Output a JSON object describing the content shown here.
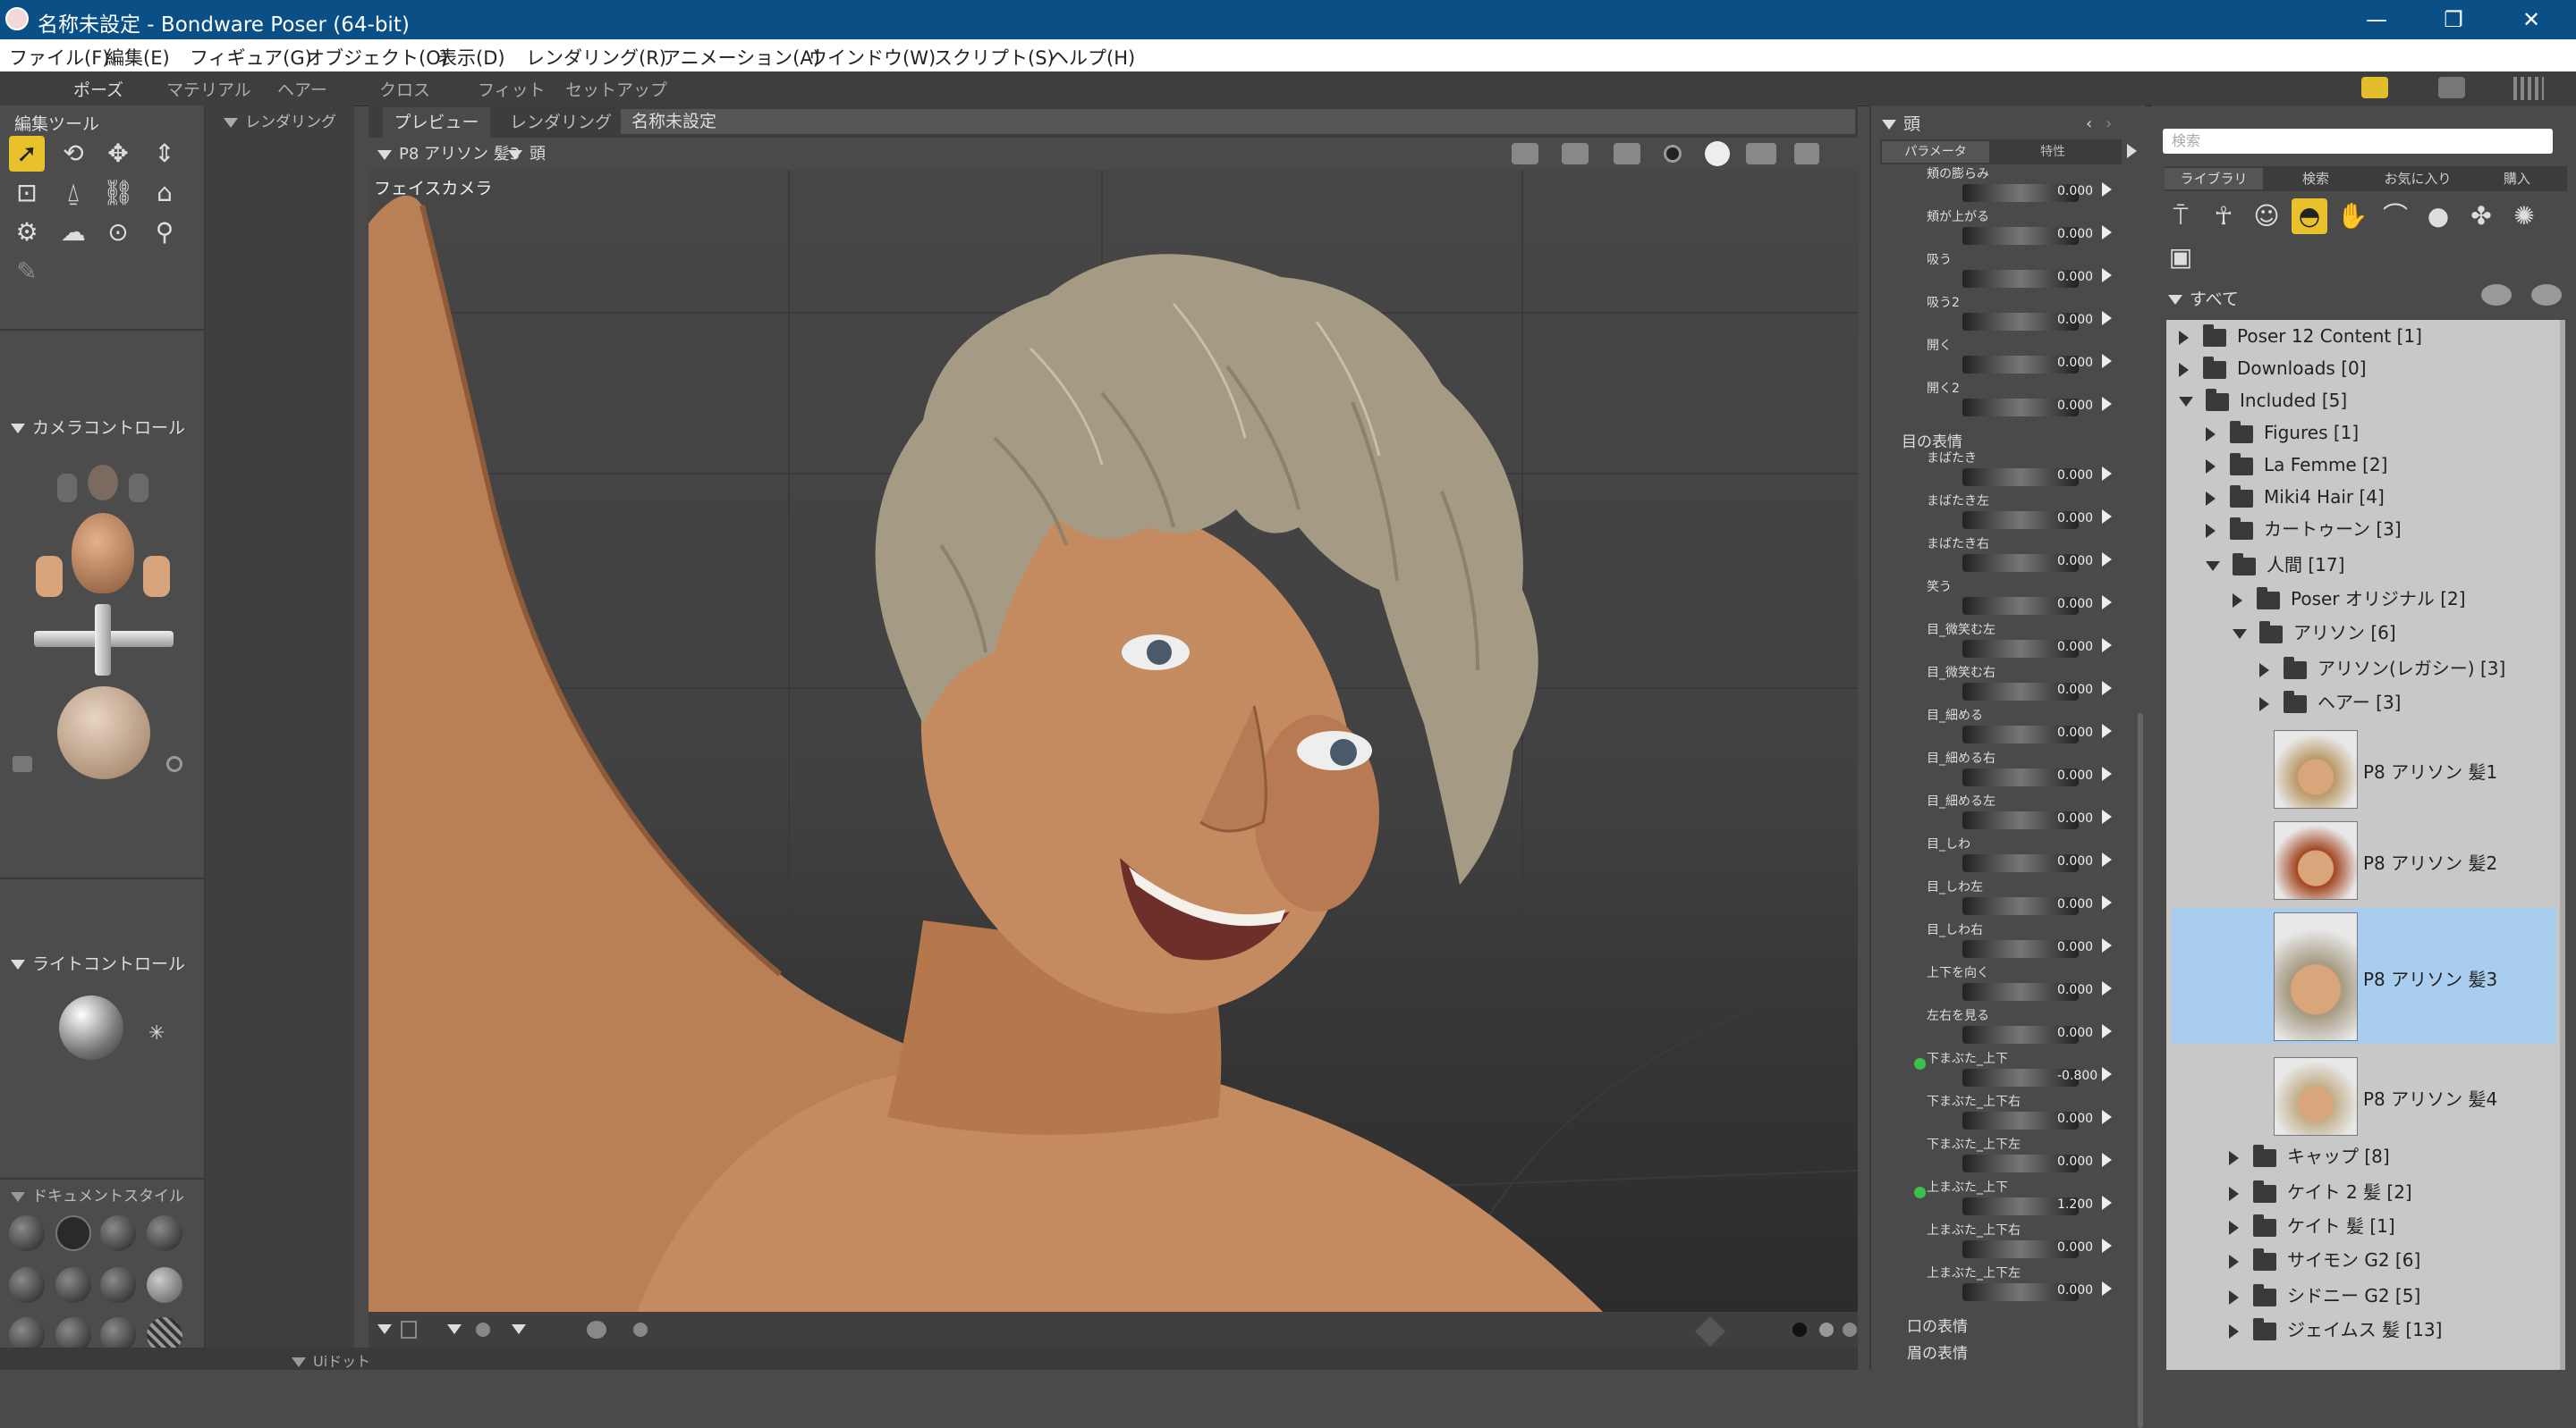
{
  "window": {
    "title": "名称未設定 - Bondware Poser (64-bit)",
    "minimize": "—",
    "restore": "❐",
    "close": "✕"
  },
  "menu": [
    "ファイル(F)",
    "編集(E)",
    "フィギュア(G)",
    "オブジェクト(O)",
    "表示(D)",
    "レンダリング(R)",
    "アニメーション(A)",
    "ウインドウ(W)",
    "スクリプト(S)",
    "ヘルプ(H)"
  ],
  "rooms": [
    "ポーズ",
    "マテリアル",
    "ヘアー",
    "クロス",
    "フィット",
    "セットアップ"
  ],
  "left": {
    "edit_tools": "編集ツール",
    "render_tab": "レンダリング",
    "camera_controls": "カメラコントロール",
    "light_controls": "ライトコントロール",
    "document_style": "ドキュメントスタイル"
  },
  "viewport": {
    "tabs": [
      "プレビュー",
      "レンダリング"
    ],
    "doc_title": "名称未設定",
    "figure_select": "P8 アリソン 髪3",
    "part_select": "頭",
    "camera_label": "フェイスカメラ"
  },
  "params": {
    "header": "頭",
    "tabs": [
      "パラメータ",
      "特性"
    ],
    "section_eye": "目の表情",
    "section_mouth": "口の表情",
    "section_eyebrow": "眉の表情",
    "rows": [
      {
        "label": "頬の膨らみ",
        "value": "0.000"
      },
      {
        "label": "頬が上がる",
        "value": "0.000"
      },
      {
        "label": "吸う",
        "value": "0.000"
      },
      {
        "label": "吸う2",
        "value": "0.000"
      },
      {
        "label": "開く",
        "value": "0.000"
      },
      {
        "label": "開く2",
        "value": "0.000"
      },
      {
        "label": "まばたき",
        "value": "0.000"
      },
      {
        "label": "まばたき左",
        "value": "0.000"
      },
      {
        "label": "まばたき右",
        "value": "0.000"
      },
      {
        "label": "笑う",
        "value": "0.000"
      },
      {
        "label": "目_微笑む左",
        "value": "0.000"
      },
      {
        "label": "目_微笑む右",
        "value": "0.000"
      },
      {
        "label": "目_細める",
        "value": "0.000"
      },
      {
        "label": "目_細める右",
        "value": "0.000"
      },
      {
        "label": "目_細める左",
        "value": "0.000"
      },
      {
        "label": "目_しわ",
        "value": "0.000"
      },
      {
        "label": "目_しわ左",
        "value": "0.000"
      },
      {
        "label": "目_しわ右",
        "value": "0.000"
      },
      {
        "label": "上下を向く",
        "value": "0.000"
      },
      {
        "label": "左右を見る",
        "value": "0.000"
      },
      {
        "label": "下まぶた_上下",
        "value": "-0.800",
        "active": true
      },
      {
        "label": "下まぶた_上下右",
        "value": "0.000"
      },
      {
        "label": "下まぶた_上下左",
        "value": "0.000"
      },
      {
        "label": "上まぶた_上下",
        "value": "1.200",
        "active": true
      },
      {
        "label": "上まぶた_上下右",
        "value": "0.000"
      },
      {
        "label": "上まぶた_上下左",
        "value": "0.000"
      }
    ]
  },
  "library": {
    "search_placeholder": "検索",
    "tabs": [
      "ライブラリ",
      "検索",
      "お気に入り",
      "購入"
    ],
    "root": "すべて",
    "tree": [
      {
        "label": "Poser 12 Content [1]",
        "depth": 0,
        "open": false
      },
      {
        "label": "Downloads [0]",
        "depth": 0,
        "open": false
      },
      {
        "label": "Included [5]",
        "depth": 0,
        "open": true
      },
      {
        "label": "Figures [1]",
        "depth": 1,
        "open": false
      },
      {
        "label": "La Femme [2]",
        "depth": 1,
        "open": false
      },
      {
        "label": "Miki4 Hair [4]",
        "depth": 1,
        "open": false
      },
      {
        "label": "カートゥーン [3]",
        "depth": 1,
        "open": false
      },
      {
        "label": "人間 [17]",
        "depth": 1,
        "open": true
      },
      {
        "label": "Poser オリジナル [2]",
        "depth": 2,
        "open": false
      },
      {
        "label": "アリソン [6]",
        "depth": 2,
        "open": true
      },
      {
        "label": "アリソン(レガシー) [3]",
        "depth": 3,
        "open": false
      },
      {
        "label": "ヘアー [3]",
        "depth": 3,
        "open": false
      }
    ],
    "items": [
      {
        "label": "P8 アリソン 髪1",
        "selected": false
      },
      {
        "label": "P8 アリソン 髪2",
        "selected": false
      },
      {
        "label": "P8 アリソン 髪3",
        "selected": true
      },
      {
        "label": "P8 アリソン 髪4",
        "selected": false
      }
    ],
    "tree_after": [
      {
        "label": "キャップ [8]"
      },
      {
        "label": "ケイト 2 髪 [2]"
      },
      {
        "label": "ケイト 髪 [1]"
      },
      {
        "label": "サイモン G2 [6]"
      },
      {
        "label": "シドニー G2 [5]"
      },
      {
        "label": "ジェイムス 髪 [13]"
      }
    ]
  },
  "bottom": {
    "tab": "Uiドット"
  },
  "colors": {
    "titlebar": "#0a4f86",
    "selection": "#a9cdef",
    "active_tool": "#e9c12a"
  }
}
